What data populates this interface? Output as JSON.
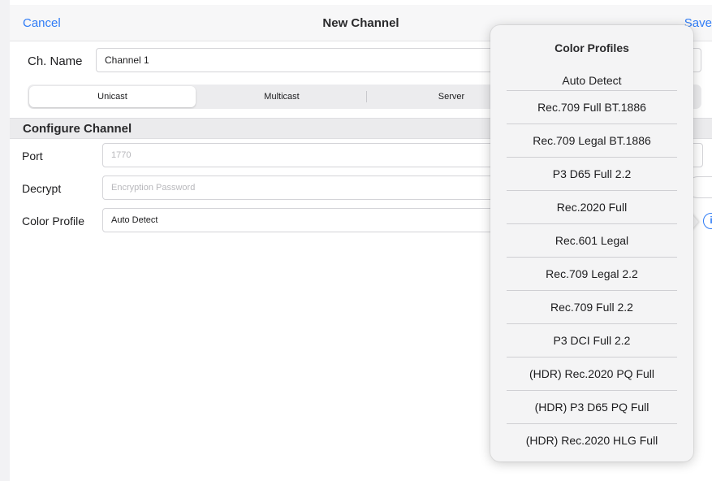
{
  "nav": {
    "cancel_label": "Cancel",
    "title": "New Channel",
    "save_label": "Save"
  },
  "channel_name": {
    "label": "Ch. Name",
    "value": "Channel 1"
  },
  "modes": {
    "selected": "Unicast",
    "options": [
      "Unicast",
      "Multicast",
      "Server"
    ]
  },
  "configure": {
    "section_title": "Configure Channel",
    "port": {
      "label": "Port",
      "placeholder": "1770"
    },
    "decrypt": {
      "label": "Decrypt",
      "placeholder": "Encryption Password"
    },
    "color_profile": {
      "label": "Color Profile",
      "value": "Auto Detect"
    }
  },
  "popover": {
    "title": "Color Profiles",
    "options": [
      "Auto Detect",
      "Rec.709 Full  BT.1886",
      "Rec.709 Legal BT.1886",
      "P3 D65 Full 2.2",
      "Rec.2020 Full",
      "Rec.601 Legal",
      "Rec.709 Legal 2.2",
      "Rec.709 Full  2.2",
      "P3 DCI Full 2.2",
      "(HDR) Rec.2020 PQ  Full",
      "(HDR) P3 D65   PQ  Full",
      "(HDR) Rec.2020 HLG Full"
    ]
  },
  "icons": {
    "info": "info-icon",
    "toggle": "decrypt-toggle"
  },
  "colors": {
    "accent": "#2f7cf6",
    "nav_background": "#f7f7f8",
    "section_background": "#ebebed",
    "popover_background": "#f4f4f5"
  }
}
